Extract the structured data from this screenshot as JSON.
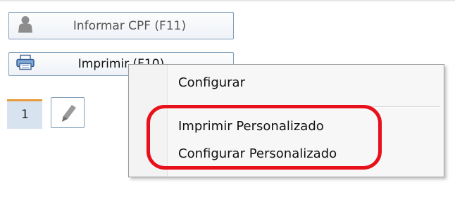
{
  "toolbar": {
    "cpf_button": {
      "label": "Informar CPF (F11)",
      "icon": "person-icon"
    },
    "print_button": {
      "label": "Imprimir (F10)",
      "icon": "printer-icon"
    }
  },
  "pager": {
    "current_page": "1",
    "edit_icon": "pencil-icon"
  },
  "context_menu": {
    "items": [
      {
        "label": "Configurar"
      },
      {
        "label": "Imprimir Personalizado"
      },
      {
        "label": "Configurar Personalizado"
      }
    ]
  },
  "annotation": {
    "color": "#e8101a"
  }
}
